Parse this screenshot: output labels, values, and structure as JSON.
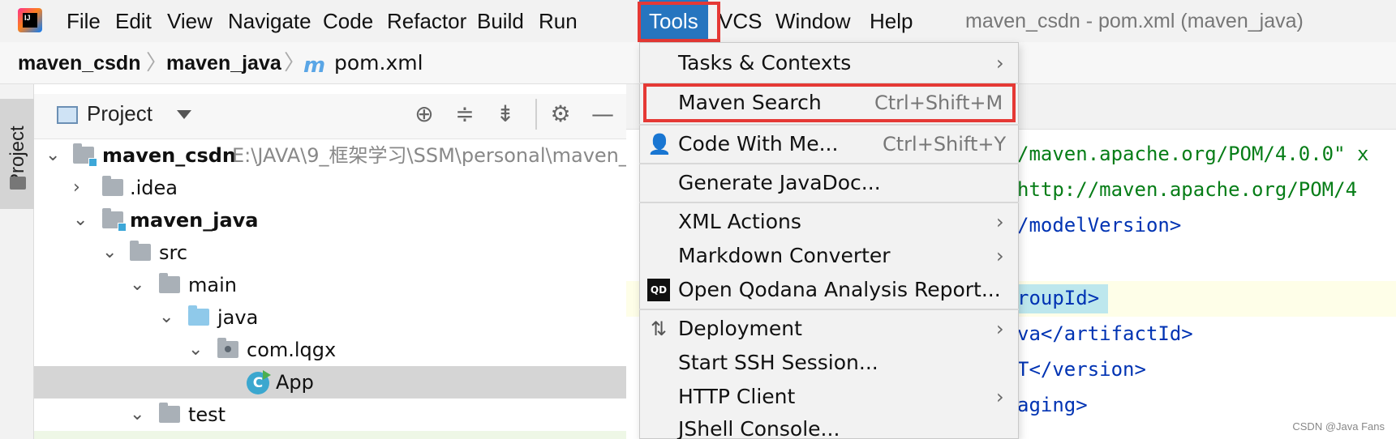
{
  "window": {
    "title": "maven_csdn - pom.xml (maven_java)"
  },
  "menubar": {
    "items": [
      {
        "label": "File"
      },
      {
        "label": "Edit"
      },
      {
        "label": "View"
      },
      {
        "label": "Navigate"
      },
      {
        "label": "Code"
      },
      {
        "label": "Refactor"
      },
      {
        "label": "Build"
      },
      {
        "label": "Run"
      },
      {
        "label": "Tools"
      },
      {
        "label": "VCS"
      },
      {
        "label": "Window"
      },
      {
        "label": "Help"
      }
    ],
    "active": "Tools"
  },
  "breadcrumb": {
    "items": [
      "maven_csdn",
      "maven_java",
      "pom.xml"
    ],
    "file_icon": "m"
  },
  "sidebar_tab": {
    "label": "Project"
  },
  "project_panel": {
    "title": "Project",
    "tools": [
      "locate-icon",
      "expand-all-icon",
      "collapse-all-icon",
      "gear-icon",
      "minimize-icon"
    ],
    "tree": [
      {
        "label": "maven_csdn",
        "path": "E:\\JAVA\\9_框架学习\\SSM\\personal\\maven_",
        "expanded": true,
        "bold": true
      },
      {
        "label": ".idea",
        "expanded": false
      },
      {
        "label": "maven_java",
        "expanded": true,
        "bold": true
      },
      {
        "label": "src",
        "expanded": true
      },
      {
        "label": "main",
        "expanded": true
      },
      {
        "label": "java",
        "expanded": true
      },
      {
        "label": "com.lqgx",
        "expanded": true
      },
      {
        "label": "App",
        "selected": true
      },
      {
        "label": "test",
        "expanded": true
      }
    ]
  },
  "editor": {
    "lines": [
      {
        "text": "/maven.apache.org/POM/4.0.0\" x"
      },
      {
        "text": "http://maven.apache.org/POM/4"
      },
      {
        "text": "/modelVersion>"
      },
      {
        "text": ""
      },
      {
        "text": "roupId>"
      },
      {
        "text": "va</artifactId>"
      },
      {
        "text": "T</version>"
      },
      {
        "text": "aging>"
      }
    ]
  },
  "tools_menu": {
    "items": [
      {
        "label": "Tasks & Contexts",
        "submenu": true
      },
      {
        "label": "Maven Search",
        "shortcut": "Ctrl+Shift+M",
        "highlighted": true
      },
      {
        "label": "Code With Me...",
        "shortcut": "Ctrl+Shift+Y",
        "icon": "code-with-me-icon"
      },
      {
        "label": "Generate JavaDoc..."
      },
      {
        "label": "XML Actions",
        "submenu": true
      },
      {
        "label": "Markdown Converter",
        "submenu": true
      },
      {
        "label": "Open Qodana Analysis Report...",
        "icon": "qodana-icon"
      },
      {
        "label": "Deployment",
        "submenu": true,
        "icon": "deployment-icon"
      },
      {
        "label": "Start SSH Session..."
      },
      {
        "label": "HTTP Client",
        "submenu": true
      },
      {
        "label": "JShell Console..."
      }
    ]
  },
  "watermark": "CSDN @Java Fans",
  "colors": {
    "menu_active": "#2675bf",
    "annotation": "#e53935",
    "selection": "#d5d5d5"
  }
}
